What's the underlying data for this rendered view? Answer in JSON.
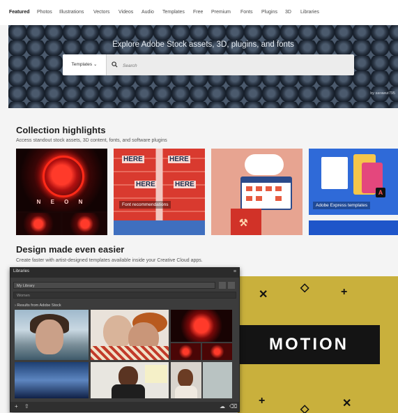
{
  "nav": {
    "items": [
      "Featured",
      "Photos",
      "Illustrations",
      "Vectors",
      "Videos",
      "Audio",
      "Templates",
      "Free",
      "Premium",
      "Fonts",
      "Plugins",
      "3D",
      "Libraries"
    ],
    "active": "Featured"
  },
  "hero": {
    "title": "Explore Adobe Stock assets, 3D, plugins, and fonts",
    "search_type": "Templates",
    "search_placeholder": "Search",
    "credit": "by sarawut795"
  },
  "collection": {
    "title": "Collection highlights",
    "subtitle": "Access standout stock assets, 3D content, fonts, and software plugins",
    "cards": [
      {
        "name": "neon",
        "word": "N E O N"
      },
      {
        "name": "here",
        "caption": "Font recommendations",
        "tiles": [
          "HERE",
          "HERE",
          "HERE",
          "HERE"
        ]
      },
      {
        "name": "cloud"
      },
      {
        "name": "express",
        "caption": "Adobe Express templates",
        "logo": "A"
      }
    ]
  },
  "design": {
    "title": "Design made even easier",
    "subtitle": "Create faster with artist-designed templates available inside your Creative Cloud apps.",
    "motion_word": "MOTION"
  },
  "libraries_panel": {
    "tab": "Libraries",
    "library": "My Library",
    "search_placeholder": "Women",
    "results_label": "Results from Adobe Stock"
  },
  "colors": {
    "hero_bg": "#1f2a38",
    "motion_bg": "#c9b03c",
    "panel_bg": "#3c3c3c",
    "express_blue": "#2f6ad8"
  }
}
